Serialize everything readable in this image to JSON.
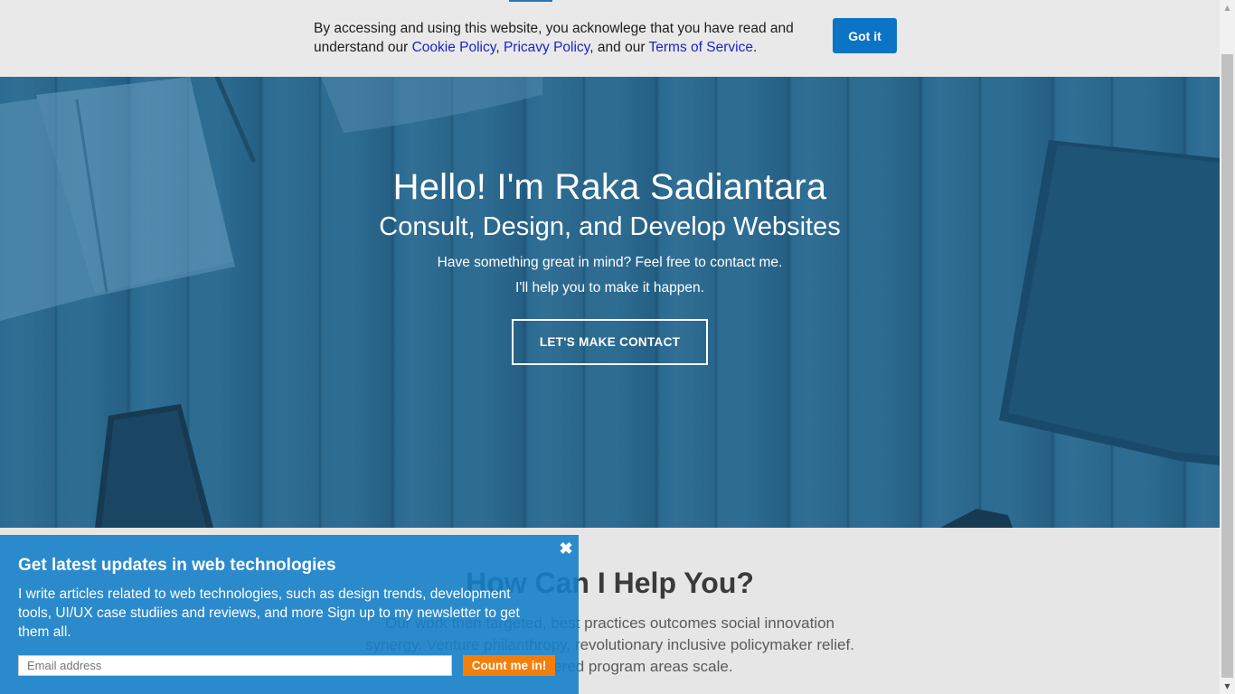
{
  "cookie": {
    "text_before": "By accessing and using this website, you acknowlege that you have read and understand our ",
    "cookie_policy": "Cookie Policy",
    "sep1": ", ",
    "privacy_policy": "Pricavy Policy",
    "sep2": ", and our ",
    "terms": "Terms of Service",
    "text_after": ".",
    "button_label": "Got it"
  },
  "hero": {
    "title": "Hello! I'm Raka Sadiantara",
    "subtitle": "Consult, Design, and Develop Websites",
    "line1": "Have something great in mind? Feel free to contact me.",
    "line2": "I'll help you to make it happen.",
    "button_label": "LET'S MAKE CONTACT"
  },
  "help": {
    "title": "How Can I Help You?",
    "lines": [
      "Our work then targeted, best practices outcomes social innovation",
      "synergy. Venture philanthropy, revolutionary inclusive policymaker relief.",
      "User-centered program areas scale."
    ]
  },
  "newsletter": {
    "close_icon": "close-icon",
    "title": "Get latest updates in web technologies",
    "body": "I write articles related to web technologies, such as design trends, development tools, UI/UX case studiies and reviews, and more Sign up to my newsletter to get them all.",
    "email_placeholder": "Email address",
    "submit_label": "Count me in!"
  },
  "colors": {
    "hero_overlay": "#2b6a91",
    "cookie_button": "#0c74c4",
    "newsletter_bg": "#1680c8",
    "submit_button": "#f47e0a",
    "link": "#1a25c9"
  }
}
